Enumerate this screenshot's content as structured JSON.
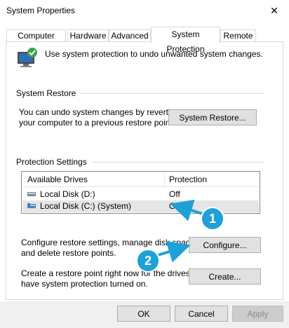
{
  "window": {
    "title": "System Properties"
  },
  "tabs": [
    {
      "label": "Computer Name",
      "active": false
    },
    {
      "label": "Hardware",
      "active": false
    },
    {
      "label": "Advanced",
      "active": false
    },
    {
      "label": "System Protection",
      "active": true
    },
    {
      "label": "Remote",
      "active": false
    }
  ],
  "intro": {
    "text": "Use system protection to undo unwanted system changes."
  },
  "system_restore": {
    "heading": "System Restore",
    "description_line1": "You can undo system changes by reverting",
    "description_line2": "your computer to a previous restore point.",
    "button": "System Restore..."
  },
  "protection": {
    "heading": "Protection Settings",
    "col_drives": "Available Drives",
    "col_protection": "Protection",
    "drives": [
      {
        "name": "Local Disk (D:)",
        "protection": "Off",
        "selected": false
      },
      {
        "name": "Local Disk (C:) (System)",
        "protection": "On",
        "selected": true
      }
    ],
    "configure_line1": "Configure restore settings, manage disk space,",
    "configure_line2": "and delete restore points.",
    "configure_button": "Configure...",
    "create_line1": "Create a restore point right now for the drives that",
    "create_line2": "have system protection turned on.",
    "create_button": "Create..."
  },
  "footer": {
    "ok": "OK",
    "cancel": "Cancel",
    "apply": "Apply"
  },
  "annotations": [
    {
      "label": "1",
      "color": "#1ea0d8"
    },
    {
      "label": "2",
      "color": "#1ea0d8"
    }
  ],
  "colors": {
    "accent": "#1ea0d8",
    "selection": "#e5e5e5",
    "button_face": "#e1e1e1"
  },
  "icons": {
    "window_close": "close-x",
    "system_protection": "computer-shield-icon",
    "drive": "hard-drive-icon"
  }
}
